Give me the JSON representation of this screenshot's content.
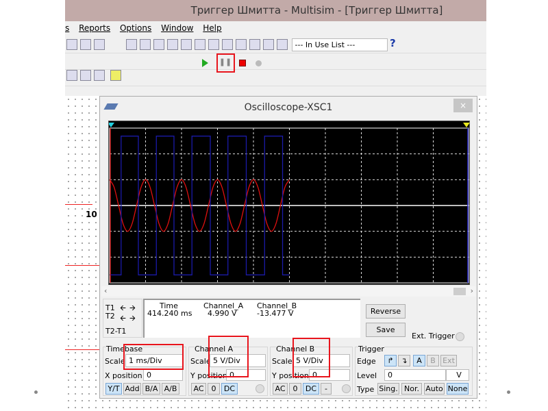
{
  "window": {
    "title": "Триггер Шмитта - Multisim - [Триггер Шмитта]"
  },
  "menu": [
    "s",
    "Reports",
    "Options",
    "Window",
    "Help"
  ],
  "toolbar": {
    "in_use_list": "--- In Use List ---",
    "help_icon": "?",
    "run": "run-icon",
    "pause": "pause-icon",
    "stop": "stop-icon"
  },
  "schematic": {
    "label": "10"
  },
  "scope": {
    "title": "Oscilloscope-XSC1",
    "close": "×",
    "cursors": {
      "t1": "T1",
      "t2": "T2",
      "diff": "T2-T1"
    },
    "readout": {
      "headers": [
        "Time",
        "Channel_A",
        "Channel_B"
      ],
      "row": [
        "414.240 ms",
        "4.990 V",
        "-13.477 V"
      ]
    },
    "reverse": "Reverse",
    "save": "Save",
    "ext_trigger": "Ext. Trigger",
    "timebase": {
      "title": "Timebase",
      "scale_label": "Scale",
      "scale": "1 ms/Div",
      "xpos_label": "X position",
      "xpos": "0",
      "modes": [
        "Y/T",
        "Add",
        "B/A",
        "A/B"
      ],
      "selected": "Y/T"
    },
    "channel_a": {
      "title": "Channel A",
      "scale_label": "Scale",
      "scale": "5  V/Div",
      "ypos_label": "Y position",
      "ypos": "0",
      "coupling": [
        "AC",
        "0",
        "DC"
      ],
      "selected": "DC"
    },
    "channel_b": {
      "title": "Channel B",
      "scale_label": "Scale",
      "scale": "5  V/Div",
      "ypos_label": "Y position",
      "ypos": "0",
      "coupling": [
        "AC",
        "0",
        "DC",
        "-"
      ],
      "selected": "DC"
    },
    "trigger": {
      "title": "Trigger",
      "edge_label": "Edge",
      "edges": [
        "rising-edge",
        "falling-edge"
      ],
      "sources": [
        "A",
        "B",
        "Ext"
      ],
      "selected_source": "A",
      "level_label": "Level",
      "level": "0",
      "level_unit": "V",
      "type_label": "Type",
      "types": [
        "Sing.",
        "Nor.",
        "Auto",
        "None"
      ],
      "selected_type": "None"
    }
  },
  "chart_data": {
    "type": "line",
    "xlim_div": [
      0,
      10
    ],
    "ylim_div": [
      -3,
      3
    ],
    "grid": true,
    "x_units": "ms",
    "x_scale": 1,
    "y_units": "V",
    "y_scale": 5,
    "series": [
      {
        "name": "Channel_A",
        "color": "#e01010",
        "t": [
          0,
          0.125,
          0.25,
          0.375,
          0.5,
          0.625,
          0.75,
          0.875,
          1,
          1.125,
          1.25,
          1.375,
          1.5,
          1.625,
          1.75,
          1.875,
          2,
          2.125,
          2.25,
          2.375,
          2.5,
          2.625,
          2.75,
          2.875,
          3,
          3.125,
          3.25,
          3.375,
          3.5,
          3.625,
          3.75,
          3.875,
          4,
          4.125,
          4.25,
          4.375,
          4.5,
          4.625,
          4.75,
          4.875,
          5
        ],
        "v": [
          5,
          3.54,
          0,
          -3.54,
          -5,
          -3.54,
          0,
          3.54,
          5,
          3.54,
          0,
          -3.54,
          -5,
          -3.54,
          0,
          3.54,
          5,
          3.54,
          0,
          -3.54,
          -5,
          -3.54,
          0,
          3.54,
          5,
          3.54,
          0,
          -3.54,
          -5,
          -3.54,
          0,
          3.54,
          5,
          3.54,
          0,
          -3.54,
          -5,
          -3.54,
          0,
          3.54,
          5
        ]
      },
      {
        "name": "Channel_B",
        "color": "#1a1aa8",
        "t": [
          0,
          0.32,
          0.32,
          0.8,
          0.8,
          1.3,
          1.3,
          1.79,
          1.79,
          2.29,
          2.29,
          2.8,
          2.8,
          3.29,
          3.29,
          3.8,
          3.8,
          4.31,
          4.31,
          4.81,
          4.81,
          5
        ],
        "v": [
          -13.45,
          -13.45,
          13.45,
          13.45,
          -13.45,
          -13.45,
          13.45,
          13.45,
          -13.45,
          -13.45,
          13.45,
          13.45,
          -13.45,
          -13.45,
          13.45,
          13.45,
          -13.45,
          -13.45,
          13.45,
          13.45,
          -13.45,
          -13.45
        ]
      }
    ]
  }
}
